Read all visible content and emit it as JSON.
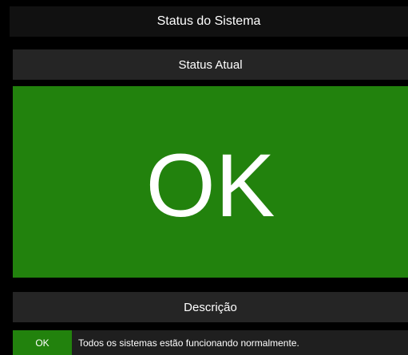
{
  "window": {
    "title": "Status do Sistema"
  },
  "status": {
    "section_title": "Status Atual",
    "value": "OK",
    "color": "#22820d"
  },
  "description": {
    "section_title": "Descrição",
    "badge": "OK",
    "text": "Todos os sistemas estão funcionando normalmente."
  },
  "colors": {
    "background": "#000000",
    "titlebar": "#111111",
    "section": "#252525",
    "success": "#22820d",
    "text": "#ffffff"
  }
}
